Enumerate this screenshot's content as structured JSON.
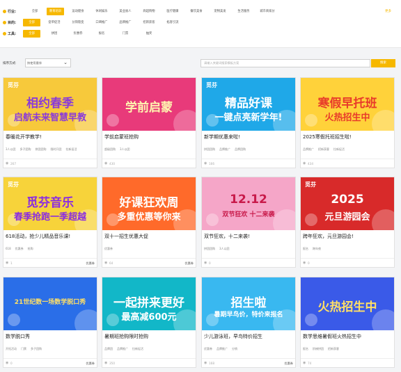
{
  "filters": {
    "industry": {
      "label": "行业:",
      "options": [
        "全部",
        "教育培训",
        "运动健身",
        "休闲娱乐",
        "美业丽人",
        "商超购物",
        "医疗健康",
        "餐饮美食",
        "宠物美发",
        "生活服务",
        "城市商家分"
      ],
      "selected": 1,
      "more": "更多"
    },
    "purpose": {
      "label": "目的:",
      "options": [
        "全部",
        "促单促活",
        "分销裂变",
        "口碑推广",
        "品牌推广",
        "招新获客",
        "拓客引流"
      ],
      "selected": 0
    },
    "tools": {
      "label": "工具:",
      "options": [
        "全部",
        "拼团",
        "优惠券",
        "报名",
        "门票",
        "抽奖"
      ],
      "selected": 0
    }
  },
  "sort": {
    "label": "排序方式:",
    "selected": "按使用量排",
    "search_placeholder": "请输入关键词搜索模板方案",
    "search_button": "搜索"
  },
  "cards": [
    {
      "title": "春暖花开学教学!",
      "tags": [
        "3人以团",
        "多子团购",
        "拼团团购",
        "限时开团",
        "拉新促活"
      ],
      "views": "267",
      "price": "",
      "thumb": {
        "bg": "#f7c93b",
        "text": "相约春季",
        "text2": "启航未来智慧早教",
        "color": "#8a3ad9",
        "logo": "觅芬"
      }
    },
    {
      "title": "学前启蒙班抢购",
      "tags": [
        "超级团购",
        "3人以团"
      ],
      "views": "430",
      "price": "",
      "thumb": {
        "bg": "#e83a7a",
        "text": "学前启蒙",
        "text2": "",
        "color": "#fff6b0",
        "logo": ""
      }
    },
    {
      "title": "新学期优惠来啦!",
      "tags": [
        "拼团团购",
        "品牌推广",
        "品牌团购"
      ],
      "views": "166",
      "price": "",
      "thumb": {
        "bg": "#1fa8e8",
        "text": "精品好课",
        "text2": "一键点亮新学年!",
        "color": "#ffffff",
        "logo": "觅芬"
      }
    },
    {
      "title": "2025寒假托班招生啦!",
      "tags": [
        "品牌推广",
        "招新获客",
        "拉新促活"
      ],
      "views": "434",
      "price": "",
      "thumb": {
        "bg": "#ffd23a",
        "text": "寒假早托班",
        "text2": "火热招生中",
        "color": "#e83a2a",
        "logo": ""
      }
    },
    {
      "title": "618活动，抢少儿精品音乐课!",
      "tags": [
        "618",
        "优惠券",
        "抢购"
      ],
      "views": "1",
      "price": "优惠券",
      "thumb": {
        "bg": "#f7d33a",
        "text": "觅芬音乐",
        "text2": "春季抢跑一季超越",
        "color": "#8a2be2",
        "logo": "觅芬"
      }
    },
    {
      "title": "双十一招生优惠大促",
      "tags": [
        "优惠券"
      ],
      "views": "64",
      "price": "优惠券",
      "thumb": {
        "bg": "#ff6a2a",
        "text": "好课狂欢周",
        "text2": "多重优惠等你来",
        "color": "#ffffff",
        "logo": ""
      }
    },
    {
      "title": "双节狂欢，十二来袭!",
      "tags": [
        "拼团团购",
        "3人以团"
      ],
      "views": "0",
      "price": "",
      "thumb": {
        "bg": "#f5a6c8",
        "text": "12.12",
        "text2": "双节狂欢 十二来袭",
        "color": "#c81a4a",
        "logo": ""
      }
    },
    {
      "title": "跨年狂欢，元旦游园会!",
      "tags": [
        "报名",
        "跨年夜"
      ],
      "views": "0",
      "price": "",
      "thumb": {
        "bg": "#d82a2a",
        "text": "2025",
        "text2": "元旦游园会",
        "color": "#ffffff",
        "logo": "觅芬"
      }
    },
    {
      "title": "数学脱口秀",
      "tags": [
        "开拓活动",
        "门票",
        "多子团购"
      ],
      "views": "0",
      "price": "优惠券",
      "thumb": {
        "bg": "#2a6ee8",
        "text": "21世纪数一场数学脱口秀",
        "text2": "",
        "color": "#ffe066",
        "logo": ""
      }
    },
    {
      "title": "暑期班抢购限时抢购",
      "tags": [
        "品牌团",
        "品牌推广",
        "拉新促活"
      ],
      "views": "350",
      "price": "",
      "thumb": {
        "bg": "#12b7c8",
        "text": "一起拼来更好",
        "text2": "最高减600元",
        "color": "#ffffff",
        "logo": ""
      }
    },
    {
      "title": "少儿游泳班，早鸟特价招生",
      "tags": [
        "优惠券",
        "品牌推广",
        "分销"
      ],
      "views": "168",
      "price": "优惠券",
      "thumb": {
        "bg": "#39b8f0",
        "text": "招生啦",
        "text2": "暑期早鸟价，特价来报名",
        "color": "#ffffff",
        "logo": ""
      }
    },
    {
      "title": "数学思维暑假班火热招生中",
      "tags": [
        "报名",
        "阶梯拼团",
        "招新获客"
      ],
      "views": "74",
      "price": "",
      "thumb": {
        "bg": "#3a5ae8",
        "text": "火热招生中",
        "text2": "",
        "color": "#ffe066",
        "logo": ""
      }
    }
  ]
}
